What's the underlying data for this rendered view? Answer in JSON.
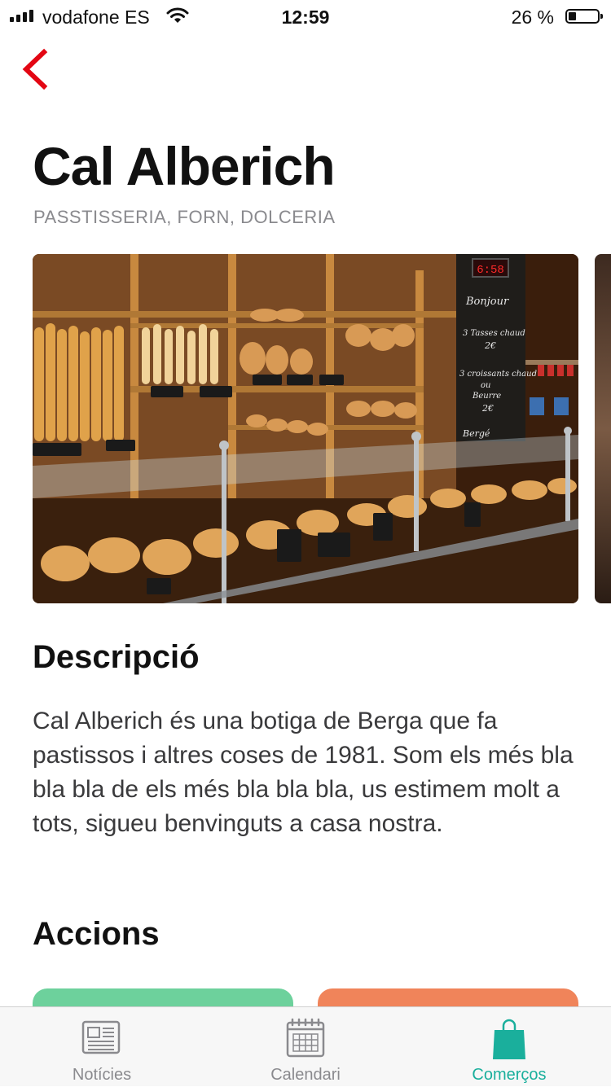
{
  "status_bar": {
    "carrier": "vodafone ES",
    "time": "12:59",
    "battery": "26 %",
    "battery_level": 0.26
  },
  "store": {
    "name": "Cal Alberich",
    "categories": "PASSTISSERIA, FORN, DOLCERIA"
  },
  "description": {
    "title": "Descripció",
    "text": "Cal Alberich és una botiga de Berga que fa pastissos i altres coses de 1981. Som els més bla bla bla de els més bla bla bla, us estimem molt a tots, sigueu benvinguts a casa nostra."
  },
  "actions": {
    "title": "Accions"
  },
  "photo_labels": {
    "clock": "6:58",
    "board_title": "Bonjour",
    "board_line1": "3 Tasses chaud",
    "board_price1": "2€",
    "board_line2": "3 croissants chaud",
    "board_line3": "ou",
    "board_line4": "Beurre",
    "board_price2": "2€",
    "board_footer": "Bergé"
  },
  "tabs": [
    {
      "label": "Notícies",
      "icon": "newspaper-icon",
      "active": false
    },
    {
      "label": "Calendari",
      "icon": "calendar-icon",
      "active": false
    },
    {
      "label": "Comerços",
      "icon": "shopping-bag-icon",
      "active": true
    }
  ],
  "colors": {
    "accent": "#1aaf9c",
    "back": "#e30613",
    "action_green": "#6dd19c",
    "action_orange": "#f0845a"
  }
}
